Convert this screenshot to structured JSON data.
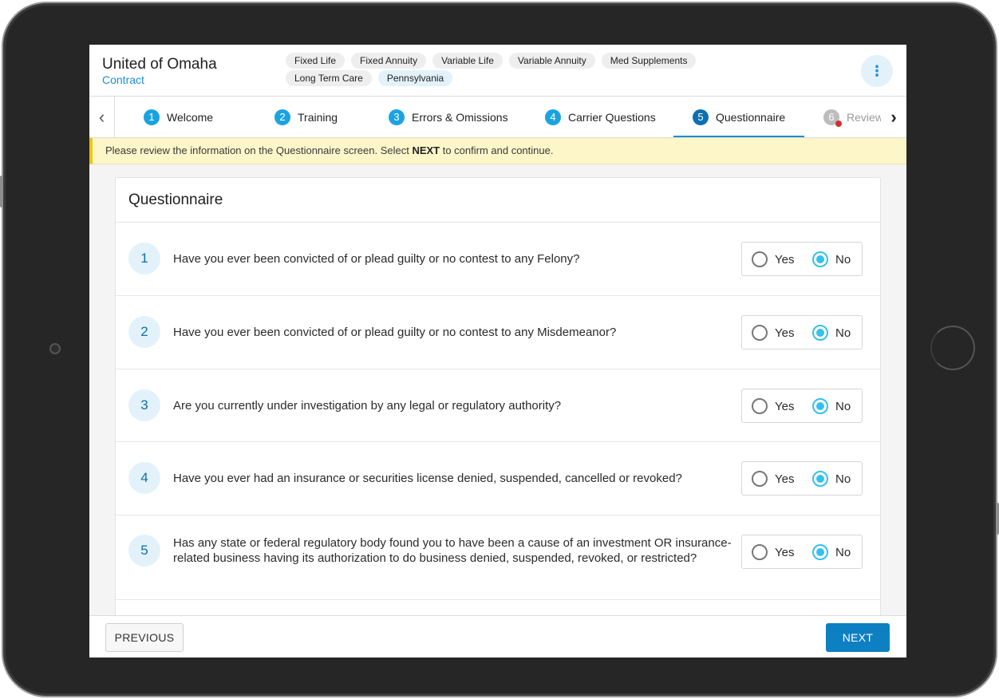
{
  "header": {
    "title": "United of Omaha",
    "subtitle": "Contract",
    "product_chips": [
      "Fixed Life",
      "Fixed Annuity",
      "Variable Life",
      "Variable Annuity",
      "Med Supplements",
      "Long Term Care"
    ],
    "state_chip": "Pennsylvania",
    "menu_icon": "⋮"
  },
  "stepper": {
    "prev_icon": "‹",
    "next_icon": "›",
    "steps": [
      {
        "num": "1",
        "label": "Welcome"
      },
      {
        "num": "2",
        "label": "Training"
      },
      {
        "num": "3",
        "label": "Errors & Omissions"
      },
      {
        "num": "4",
        "label": "Carrier Questions"
      },
      {
        "num": "5",
        "label": "Questionnaire"
      },
      {
        "num": "6",
        "label": "Review"
      }
    ],
    "active_step": "Questionnaire"
  },
  "banner": {
    "text_before": "Please review the information on the Questionnaire screen. Select ",
    "text_bold": "NEXT",
    "text_after": " to confirm and continue."
  },
  "questionnaire": {
    "title": "Questionnaire",
    "yes_label": "Yes",
    "no_label": "No",
    "questions": [
      {
        "num": "1",
        "text": "Have you ever been convicted of or plead guilty or no contest to any Felony?",
        "answer": "No"
      },
      {
        "num": "2",
        "text": "Have you ever been convicted of or plead guilty or no contest to any Misdemeanor?",
        "answer": "No"
      },
      {
        "num": "3",
        "text": "Are you currently under investigation by any legal or regulatory authority?",
        "answer": "No"
      },
      {
        "num": "4",
        "text": "Have you ever had an insurance or securities license denied, suspended, cancelled or revoked?",
        "answer": "No"
      },
      {
        "num": "5",
        "text": "Has any state or federal regulatory body found you to have been a cause of an investment OR insurance-related business having its authorization to do business denied, suspended, revoked, or restricted?",
        "answer": "No"
      }
    ]
  },
  "footer": {
    "previous_label": "PREVIOUS",
    "next_label": "NEXT"
  },
  "colors": {
    "accent": "#1a8fd1",
    "primary_button": "#0d7fc3",
    "radio_checked": "#35c0ee",
    "banner_bg": "#fdf6c9",
    "banner_border": "#f3c40f"
  }
}
